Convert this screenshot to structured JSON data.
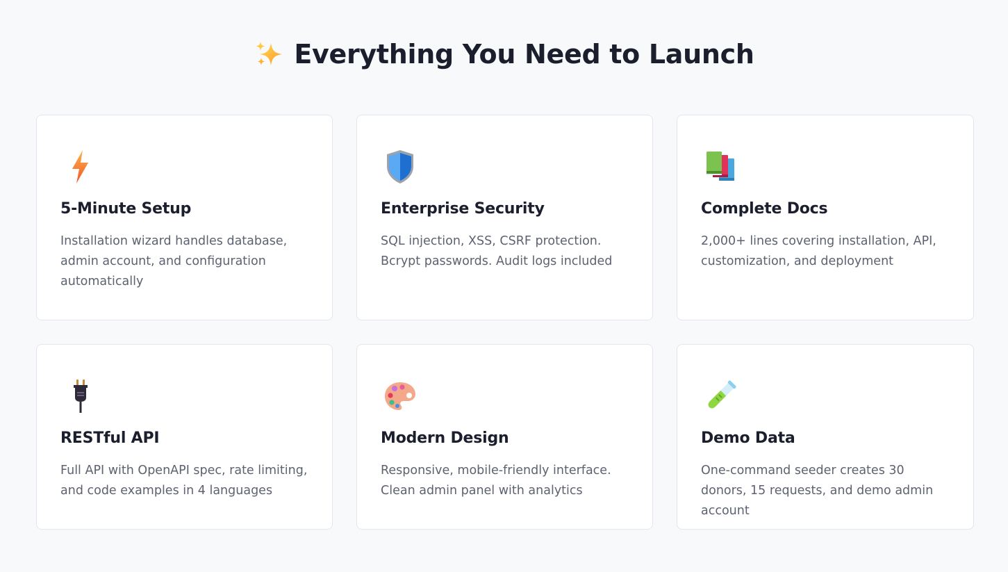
{
  "section": {
    "title": "Everything You Need to Launch",
    "title_icon": "sparkles-icon"
  },
  "features": [
    {
      "icon": "lightning-bolt-icon",
      "title": "5-Minute Setup",
      "description": "Installation wizard handles database, admin account, and configuration automatically"
    },
    {
      "icon": "shield-icon",
      "title": "Enterprise Security",
      "description": "SQL injection, XSS, CSRF protection. Bcrypt passwords. Audit logs included"
    },
    {
      "icon": "books-icon",
      "title": "Complete Docs",
      "description": "2,000+ lines covering installation, API, customization, and deployment"
    },
    {
      "icon": "electric-plug-icon",
      "title": "RESTful API",
      "description": "Full API with OpenAPI spec, rate limiting, and code examples in 4 languages"
    },
    {
      "icon": "artist-palette-icon",
      "title": "Modern Design",
      "description": "Responsive, mobile-friendly interface. Clean admin panel with analytics"
    },
    {
      "icon": "test-tube-icon",
      "title": "Demo Data",
      "description": "One-command seeder creates 30 donors, 15 requests, and demo admin account"
    }
  ],
  "colors": {
    "page_background": "#f8f9fb",
    "card_background": "#ffffff",
    "card_border": "#e3e6ec",
    "title_text": "#1b1e2c",
    "body_text": "#5d6270"
  }
}
